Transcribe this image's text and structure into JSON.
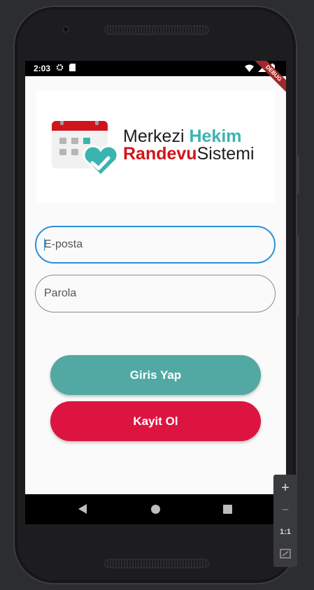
{
  "status_bar": {
    "time": "2:03",
    "debug_label": "DEBUG"
  },
  "logo": {
    "line1_plain": "Merkezi",
    "line1_accent": "Hekim",
    "line2_accent": "Randevu",
    "line2_plain": "Sistemi"
  },
  "form": {
    "email": {
      "placeholder": "E-posta",
      "value": ""
    },
    "password": {
      "placeholder": "Parola",
      "value": ""
    }
  },
  "buttons": {
    "login_label": "Giris Yap",
    "register_label": "Kayit Ol"
  },
  "emulator": {
    "zoom_in": "+",
    "zoom_out": "−",
    "one_to_one": "1:1"
  },
  "colors": {
    "login_button": "#52a8a3",
    "register_button": "#dd1440",
    "logo_teal": "#3bb4b0",
    "logo_red": "#d0141b",
    "focus_border": "#2a91d7"
  }
}
